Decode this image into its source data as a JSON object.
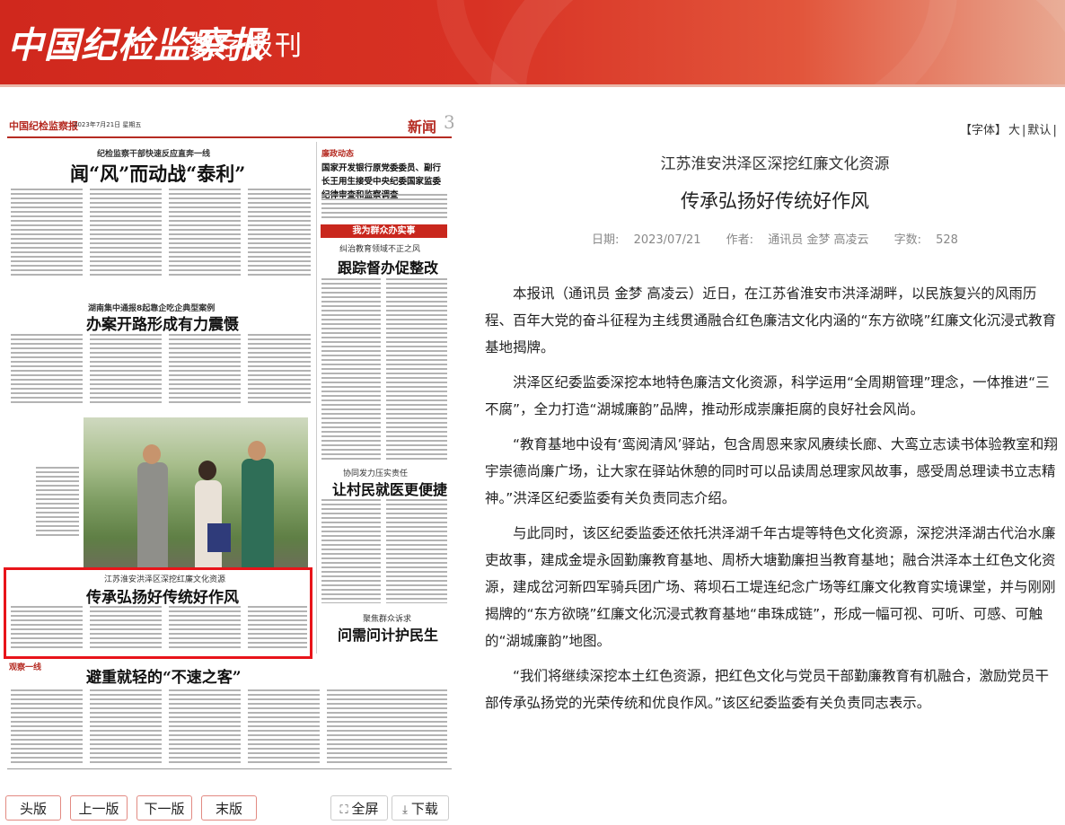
{
  "header": {
    "logo": "中国纪检监察报",
    "subtitle": "数字报刊"
  },
  "paper": {
    "masthead": "中国纪检监察报",
    "date": "2023年7月21日  星期五",
    "section": "新闻",
    "page_number": "3",
    "stories": [
      {
        "kicker": "纪检监察干部快速反应直奔一线",
        "headline": "闻“风”而动战“泰利”"
      },
      {
        "kicker": "湖南集中通报8起靠企吃企典型案例",
        "headline": "办案开路形成有力震慑"
      },
      {
        "kicker": "江苏淮安洪泽区深挖红廉文化资源",
        "headline": "传承弘扬好传统好作风"
      },
      {
        "kicker": "",
        "headline": "避重就轻的“不速之客”"
      }
    ],
    "right_column": {
      "tag": "廉政动态",
      "headline": "国家开发银行原党委委员、副行长王用生接受中央纪委国家监委纪律审查和监察调查",
      "banner": "我为群众办实事",
      "sub_stories": [
        {
          "kicker": "纠治教育领域不正之风",
          "headline": "跟踪督办促整改"
        },
        {
          "kicker": "协同发力压实责任",
          "headline": "让村民就医更便捷"
        },
        {
          "kicker": "聚焦群众诉求",
          "headline": "问需问计护民生"
        }
      ]
    },
    "bottom_tag": "观察一线"
  },
  "nav": {
    "first": "头版",
    "prev": "上一版",
    "next": "下一版",
    "last": "末版",
    "fullscreen": "全屏",
    "download": "下载"
  },
  "font_bar": {
    "open": "【字体】",
    "large": "大",
    "sep": "|",
    "default": "默认",
    "close": "|"
  },
  "article": {
    "kicker": "江苏淮安洪泽区深挖红廉文化资源",
    "title": "传承弘扬好传统好作风",
    "date_label": "日期:",
    "date": "2023/07/21",
    "author_label": "作者:",
    "author": "通讯员 金梦 高凌云",
    "words_label": "字数:",
    "words": "528",
    "paragraphs": [
      "本报讯（通讯员 金梦 高凌云）近日，在江苏省淮安市洪泽湖畔，以民族复兴的风雨历程、百年大党的奋斗征程为主线贯通融合红色廉洁文化内涵的“东方欲晓”红廉文化沉浸式教育基地揭牌。",
      "洪泽区纪委监委深挖本地特色廉洁文化资源，科学运用“全周期管理”理念，一体推进“三不腐”，全力打造“湖城廉韵”品牌，推动形成崇廉拒腐的良好社会风尚。",
      "“教育基地中设有‘鸾阅清风’驿站，包含周恩来家风赓续长廊、大鸾立志读书体验教室和翔宇崇德尚廉广场，让大家在驿站休憩的同时可以品读周总理家风故事，感受周总理读书立志精神。”洪泽区纪委监委有关负责同志介绍。",
      "与此同时，该区纪委监委还依托洪泽湖千年古堤等特色文化资源，深挖洪泽湖古代治水廉吏故事，建成金堤永固勤廉教育基地、周桥大塘勤廉担当教育基地；融合洪泽本土红色文化资源，建成岔河新四军骑兵团广场、蒋坝石工堤连纪念广场等红廉文化教育实境课堂，并与刚刚揭牌的“东方欲晓”红廉文化沉浸式教育基地“串珠成链”，形成一幅可视、可听、可感、可触的“湖城廉韵”地图。",
      "“我们将继续深挖本土红色资源，把红色文化与党员干部勤廉教育有机融合，激励党员干部传承弘扬党的光荣传统和优良作风。”该区纪委监委有关负责同志表示。"
    ]
  },
  "colors": {
    "header_red": "#d0281d",
    "highlight": "#e8141a",
    "button_border": "#e28a82"
  }
}
